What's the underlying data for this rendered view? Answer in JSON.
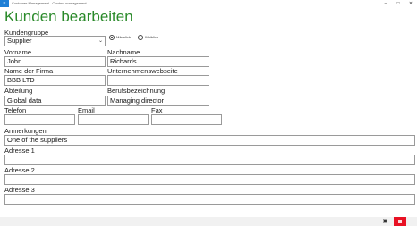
{
  "window": {
    "title": "Customer Management - Contact management"
  },
  "page": {
    "title": "Kunden bearbeiten"
  },
  "form": {
    "kundengruppe": {
      "label": "Kundengruppe",
      "value": "Supplier"
    },
    "radio_male": {
      "label": "Männlich",
      "selected": true
    },
    "radio_female": {
      "label": "Weiblich",
      "selected": false
    },
    "vorname": {
      "label": "Vorname",
      "value": "John"
    },
    "nachname": {
      "label": "Nachname",
      "value": "Richards"
    },
    "firma": {
      "label": "Name der Firma",
      "value": "BBB LTD"
    },
    "webseite": {
      "label": "Unternehmenswebseite",
      "value": ""
    },
    "abteilung": {
      "label": "Abteilung",
      "value": "Global data"
    },
    "berufsbezeichnung": {
      "label": "Berufsbezeichnung",
      "value": "Managing director"
    },
    "telefon": {
      "label": "Telefon",
      "value": ""
    },
    "email": {
      "label": "Email",
      "value": ""
    },
    "fax": {
      "label": "Fax",
      "value": ""
    },
    "anmerkungen": {
      "label": "Anmerkungen",
      "value": "One of the suppliers"
    },
    "adresse1": {
      "label": "Adresse 1",
      "value": ""
    },
    "adresse2": {
      "label": "Adresse 2",
      "value": ""
    },
    "adresse3": {
      "label": "Adresse 3",
      "value": ""
    }
  },
  "colors": {
    "title_green": "#2a8a2a",
    "accent_blue": "#1e7fd6",
    "delete_red": "#e81123"
  },
  "icons": {
    "app": "app-icon",
    "save": "save-icon",
    "delete": "delete-icon"
  }
}
